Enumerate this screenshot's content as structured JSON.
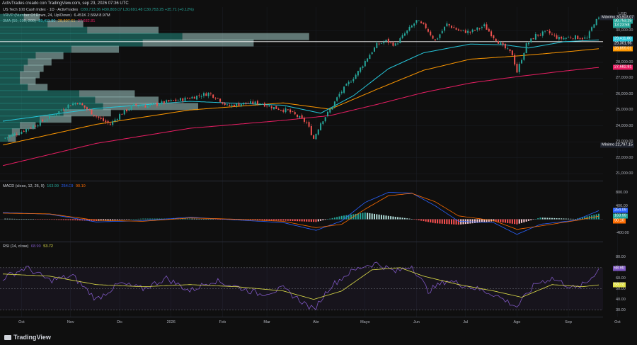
{
  "header": {
    "text": "ActivTrades creado con TradingView.com, sep 23, 2026 07:36 UTC"
  },
  "legends": {
    "main": {
      "symbol": "US Tech 100 Cash Index · 1D · ActivTrades",
      "ohlc": "O30,713.36  H30,803.07  L30,691.48  C30,753.25  +35.71 (+0.12%)"
    },
    "vrvp": {
      "label": "VRVP (Number Of Rows, 24, Up/Down)",
      "values": "6.451K  2.56M  8.97M"
    },
    "sma": {
      "label": "3MA (50, 100, 200)",
      "v1": "29,411.80",
      "v2": "28,807.61",
      "v3": "27,682.81"
    },
    "macd": {
      "label": "MACD (close, 12, 26, 9)",
      "v1": "163.99",
      "v2": "254.09",
      "v3": "90.10"
    },
    "rsi": {
      "label": "RSI (14, close)",
      "v1": "68.90",
      "v2": "53.72"
    }
  },
  "colors": {
    "up": "#26a69a",
    "down": "#ef5350",
    "sma50": "#26c6da",
    "sma100": "#ff9800",
    "sma200": "#e91e63",
    "macd": "#2962ff",
    "signal": "#ff6d00",
    "rsi": "#7e57c2",
    "rsima": "#e1e14a"
  },
  "axis": {
    "currency": "USD",
    "price_ticks": [
      "30,000.00",
      "29,000.00",
      "28,000.00",
      "27,000.00",
      "26,000.00",
      "25,000.00",
      "24,000.00",
      "23,000.00",
      "22,000.00",
      "21,000.00"
    ],
    "price_tick_values": [
      30000,
      29000,
      28000,
      27000,
      26000,
      25000,
      24000,
      23000,
      22000,
      21000
    ],
    "macd_ticks": [
      "800.00",
      "400.00",
      "-400.00"
    ],
    "macd_tick_values": [
      800,
      400,
      -400
    ],
    "rsi_ticks": [
      "80.00",
      "70.00",
      "60.00",
      "50.00",
      "40.00",
      "30.00"
    ],
    "rsi_tick_values": [
      80,
      70,
      60,
      50,
      40,
      30
    ],
    "badges": [
      {
        "label": "Máximo",
        "text": "30,803.07",
        "value": 30803,
        "pane": "price",
        "color": "#1e222d"
      },
      {
        "label": "",
        "text": "30,753.25",
        "value": 30600,
        "pane": "price",
        "color": "#26a69a"
      },
      {
        "label": "",
        "text": "13:23:58",
        "value": 30300,
        "pane": "price",
        "color": "#26a69a"
      },
      {
        "label": "",
        "text": "29,411.80",
        "value": 29450,
        "pane": "price",
        "color": "#26c6da"
      },
      {
        "label": "",
        "text": "29,301.96",
        "value": 29180,
        "pane": "price",
        "color": "#1e222d"
      },
      {
        "label": "",
        "text": "28,859.01",
        "value": 28850,
        "pane": "price",
        "color": "#ff9800"
      },
      {
        "label": "",
        "text": "27,682.81",
        "value": 27682,
        "pane": "price",
        "color": "#e91e63"
      },
      {
        "label": "Mínimo",
        "text": "22,797.15",
        "value": 22797,
        "pane": "price",
        "color": "#1e222d"
      },
      {
        "label": "",
        "text": "254.09",
        "value": 254,
        "pane": "macd",
        "color": "#2962ff"
      },
      {
        "label": "",
        "text": "163.99",
        "value": 100,
        "pane": "macd",
        "color": "#26a69a"
      },
      {
        "label": "",
        "text": "90.10",
        "value": -60,
        "pane": "macd",
        "color": "#ff6d00"
      },
      {
        "label": "",
        "text": "68.90",
        "value": 68.9,
        "pane": "rsi",
        "color": "#7e57c2"
      },
      {
        "label": "",
        "text": "53.72",
        "value": 53.7,
        "pane": "rsi",
        "color": "#e1e14a"
      }
    ],
    "months": [
      "Oct",
      "Nov",
      "Dic",
      "2026",
      "Feb",
      "Mar",
      "Abr",
      "Mayo",
      "Jun",
      "Jul",
      "Ago",
      "Sep",
      "Oct"
    ],
    "month_index": [
      8,
      29,
      50,
      72,
      94,
      113,
      134,
      155,
      177,
      198,
      220,
      242,
      263
    ]
  },
  "footer": {
    "brand": "TradingView"
  },
  "chart_data": {
    "type": "candlestick",
    "title": "US Tech 100 Cash Index · 1D · ActivTrades",
    "bars": 255,
    "price_range": [
      20600,
      31300
    ],
    "close_path": [
      [
        0,
        23200
      ],
      [
        8,
        23650
      ],
      [
        15,
        24150
      ],
      [
        22,
        24700
      ],
      [
        28,
        25300
      ],
      [
        32,
        25500
      ],
      [
        36,
        25050
      ],
      [
        42,
        24400
      ],
      [
        46,
        24100
      ],
      [
        50,
        24700
      ],
      [
        56,
        25300
      ],
      [
        62,
        25250
      ],
      [
        70,
        25500
      ],
      [
        78,
        25700
      ],
      [
        88,
        26050
      ],
      [
        92,
        25750
      ],
      [
        96,
        25250
      ],
      [
        102,
        25400
      ],
      [
        110,
        25450
      ],
      [
        116,
        25150
      ],
      [
        122,
        24950
      ],
      [
        126,
        24600
      ],
      [
        130,
        24200
      ],
      [
        133,
        23200
      ],
      [
        136,
        24200
      ],
      [
        140,
        25000
      ],
      [
        144,
        26000
      ],
      [
        148,
        26700
      ],
      [
        152,
        27400
      ],
      [
        156,
        28300
      ],
      [
        160,
        29100
      ],
      [
        164,
        29350
      ],
      [
        168,
        29100
      ],
      [
        172,
        29800
      ],
      [
        177,
        30600
      ],
      [
        181,
        30200
      ],
      [
        185,
        29350
      ],
      [
        190,
        30400
      ],
      [
        195,
        30000
      ],
      [
        200,
        29900
      ],
      [
        206,
        30300
      ],
      [
        210,
        29600
      ],
      [
        214,
        29000
      ],
      [
        218,
        28500
      ],
      [
        220,
        27400
      ],
      [
        224,
        29100
      ],
      [
        228,
        29700
      ],
      [
        233,
        29900
      ],
      [
        238,
        29500
      ],
      [
        244,
        29600
      ],
      [
        250,
        29500
      ],
      [
        253,
        30500
      ],
      [
        255,
        30753
      ]
    ],
    "sma50_path": [
      [
        0,
        24300
      ],
      [
        40,
        25100
      ],
      [
        80,
        25550
      ],
      [
        120,
        25300
      ],
      [
        136,
        24800
      ],
      [
        150,
        25900
      ],
      [
        165,
        27600
      ],
      [
        180,
        28600
      ],
      [
        200,
        29150
      ],
      [
        215,
        29100
      ],
      [
        225,
        28900
      ],
      [
        240,
        29300
      ],
      [
        255,
        29411
      ]
    ],
    "sma100_path": [
      [
        0,
        22800
      ],
      [
        40,
        24100
      ],
      [
        80,
        25000
      ],
      [
        120,
        25450
      ],
      [
        140,
        25050
      ],
      [
        160,
        26300
      ],
      [
        180,
        27500
      ],
      [
        200,
        28200
      ],
      [
        220,
        28400
      ],
      [
        240,
        28650
      ],
      [
        255,
        28859
      ]
    ],
    "sma200_path": [
      [
        0,
        21500
      ],
      [
        40,
        22900
      ],
      [
        80,
        23850
      ],
      [
        120,
        24350
      ],
      [
        140,
        24650
      ],
      [
        160,
        25350
      ],
      [
        180,
        26100
      ],
      [
        200,
        26700
      ],
      [
        220,
        27100
      ],
      [
        240,
        27450
      ],
      [
        255,
        27682
      ]
    ],
    "vrvp_profile": [
      {
        "price": 30800,
        "up": 0.06,
        "down": 0.04
      },
      {
        "price": 30400,
        "up": 0.12,
        "down": 0.09
      },
      {
        "price": 30000,
        "up": 0.22,
        "down": 0.18
      },
      {
        "price": 29600,
        "up": 0.46,
        "down": 0.32
      },
      {
        "price": 29200,
        "up": 0.36,
        "down": 0.28
      },
      {
        "price": 28800,
        "up": 0.18,
        "down": 0.12
      },
      {
        "price": 28400,
        "up": 0.09,
        "down": 0.07
      },
      {
        "price": 28000,
        "up": 0.07,
        "down": 0.06
      },
      {
        "price": 27600,
        "up": 0.06,
        "down": 0.05
      },
      {
        "price": 27200,
        "up": 0.05,
        "down": 0.05
      },
      {
        "price": 26800,
        "up": 0.05,
        "down": 0.04
      },
      {
        "price": 26400,
        "up": 0.07,
        "down": 0.05
      },
      {
        "price": 26000,
        "up": 0.2,
        "down": 0.14
      },
      {
        "price": 25600,
        "up": 0.24,
        "down": 0.16
      },
      {
        "price": 25200,
        "up": 0.26,
        "down": 0.24
      },
      {
        "price": 24800,
        "up": 0.16,
        "down": 0.12
      },
      {
        "price": 24400,
        "up": 0.1,
        "down": 0.08
      },
      {
        "price": 24000,
        "up": 0.05,
        "down": 0.04
      },
      {
        "price": 23600,
        "up": 0.03,
        "down": 0.02
      },
      {
        "price": 23200,
        "up": 0.02,
        "down": 0.02
      }
    ],
    "poc_price": 29301.96,
    "macd_path": [
      [
        0,
        200
      ],
      [
        20,
        150
      ],
      [
        40,
        -80
      ],
      [
        60,
        -40
      ],
      [
        80,
        60
      ],
      [
        100,
        -20
      ],
      [
        120,
        -100
      ],
      [
        134,
        -330
      ],
      [
        145,
        -50
      ],
      [
        155,
        500
      ],
      [
        165,
        800
      ],
      [
        175,
        780
      ],
      [
        185,
        400
      ],
      [
        195,
        -60
      ],
      [
        210,
        -100
      ],
      [
        220,
        -450
      ],
      [
        230,
        -150
      ],
      [
        245,
        -30
      ],
      [
        255,
        254
      ]
    ],
    "signal_path": [
      [
        0,
        180
      ],
      [
        20,
        160
      ],
      [
        40,
        -30
      ],
      [
        60,
        -60
      ],
      [
        80,
        40
      ],
      [
        100,
        0
      ],
      [
        120,
        -60
      ],
      [
        134,
        -250
      ],
      [
        145,
        -150
      ],
      [
        155,
        300
      ],
      [
        165,
        700
      ],
      [
        175,
        770
      ],
      [
        185,
        520
      ],
      [
        195,
        100
      ],
      [
        210,
        -40
      ],
      [
        220,
        -300
      ],
      [
        230,
        -200
      ],
      [
        245,
        -40
      ],
      [
        255,
        90
      ]
    ],
    "rsi_path": [
      [
        0,
        60
      ],
      [
        10,
        70
      ],
      [
        20,
        58
      ],
      [
        30,
        62
      ],
      [
        40,
        40
      ],
      [
        50,
        55
      ],
      [
        60,
        50
      ],
      [
        70,
        60
      ],
      [
        80,
        48
      ],
      [
        90,
        58
      ],
      [
        100,
        52
      ],
      [
        110,
        45
      ],
      [
        120,
        50
      ],
      [
        128,
        38
      ],
      [
        133,
        30
      ],
      [
        140,
        52
      ],
      [
        148,
        65
      ],
      [
        155,
        72
      ],
      [
        160,
        74
      ],
      [
        168,
        66
      ],
      [
        175,
        72
      ],
      [
        182,
        48
      ],
      [
        190,
        58
      ],
      [
        200,
        52
      ],
      [
        210,
        45
      ],
      [
        220,
        33
      ],
      [
        228,
        55
      ],
      [
        235,
        60
      ],
      [
        245,
        50
      ],
      [
        250,
        56
      ],
      [
        255,
        69
      ]
    ],
    "rsima_path": [
      [
        0,
        64
      ],
      [
        20,
        62
      ],
      [
        40,
        54
      ],
      [
        60,
        52
      ],
      [
        80,
        54
      ],
      [
        100,
        52
      ],
      [
        120,
        48
      ],
      [
        133,
        40
      ],
      [
        145,
        48
      ],
      [
        158,
        68
      ],
      [
        170,
        70
      ],
      [
        180,
        62
      ],
      [
        195,
        54
      ],
      [
        210,
        48
      ],
      [
        222,
        42
      ],
      [
        235,
        54
      ],
      [
        248,
        52
      ],
      [
        255,
        53.7
      ]
    ]
  }
}
